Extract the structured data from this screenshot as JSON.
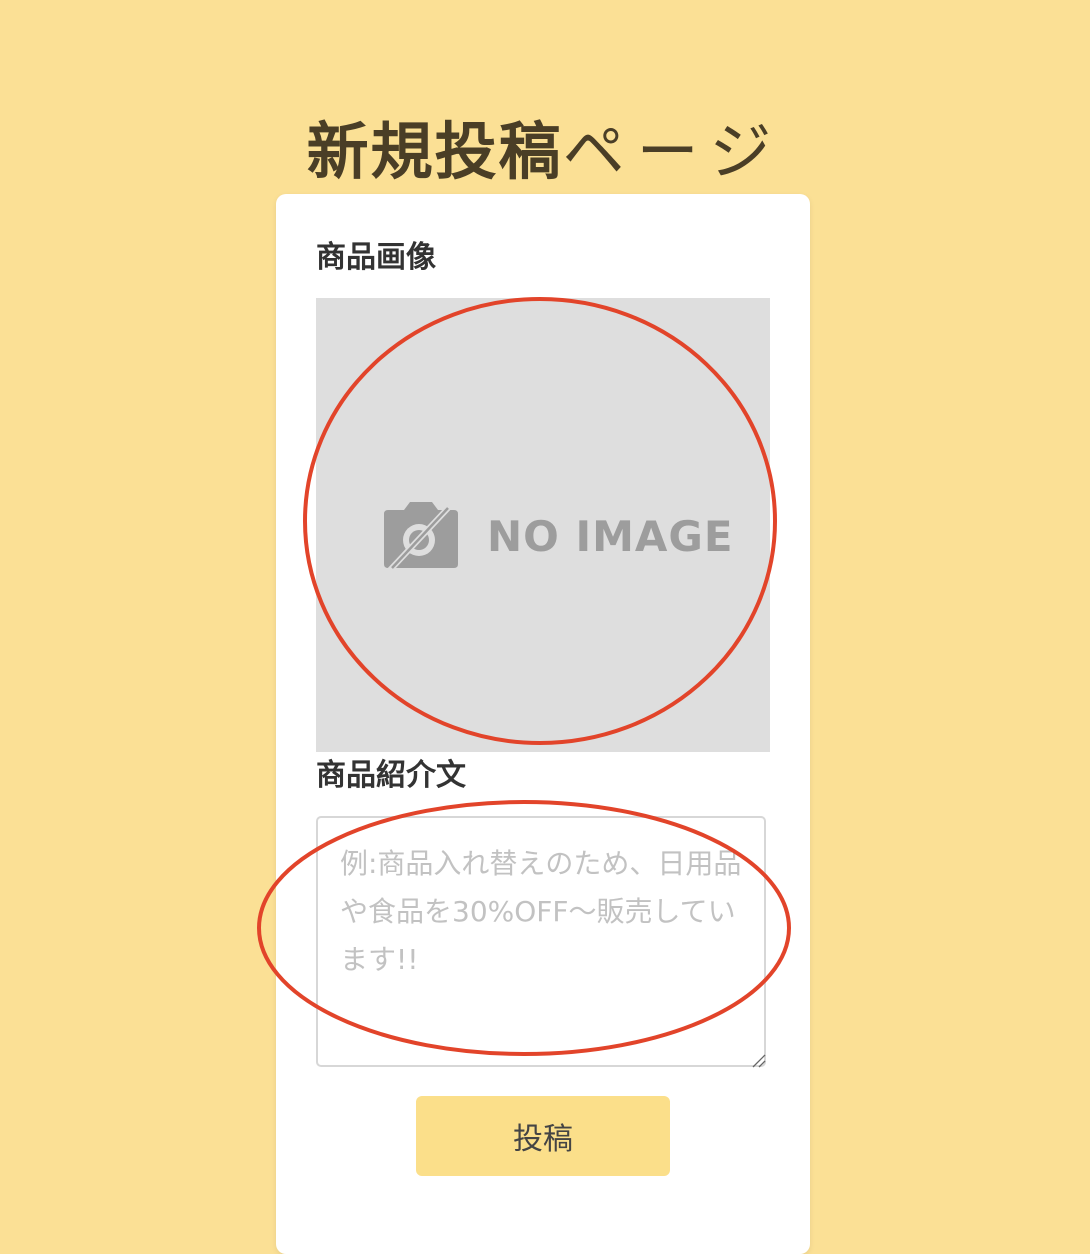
{
  "page": {
    "title_main": "新規投稿",
    "title_suffix": "ページ"
  },
  "form": {
    "image_label": "商品画像",
    "image_placeholder_text": "NO IMAGE",
    "description_label": "商品紹介文",
    "description_value": "",
    "description_placeholder": "例:商品入れ替えのため、日用品や食品を30%OFF〜販売しています!!",
    "submit_label": "投稿"
  },
  "icons": {
    "camera": "camera-off-icon",
    "resize": "resize-grip-icon"
  },
  "colors": {
    "background": "#fbe095",
    "card": "#ffffff",
    "image_placeholder_bg": "#dedede",
    "button": "#fbdf8a",
    "annotation": "#e2442a",
    "title": "#4a3e26"
  }
}
